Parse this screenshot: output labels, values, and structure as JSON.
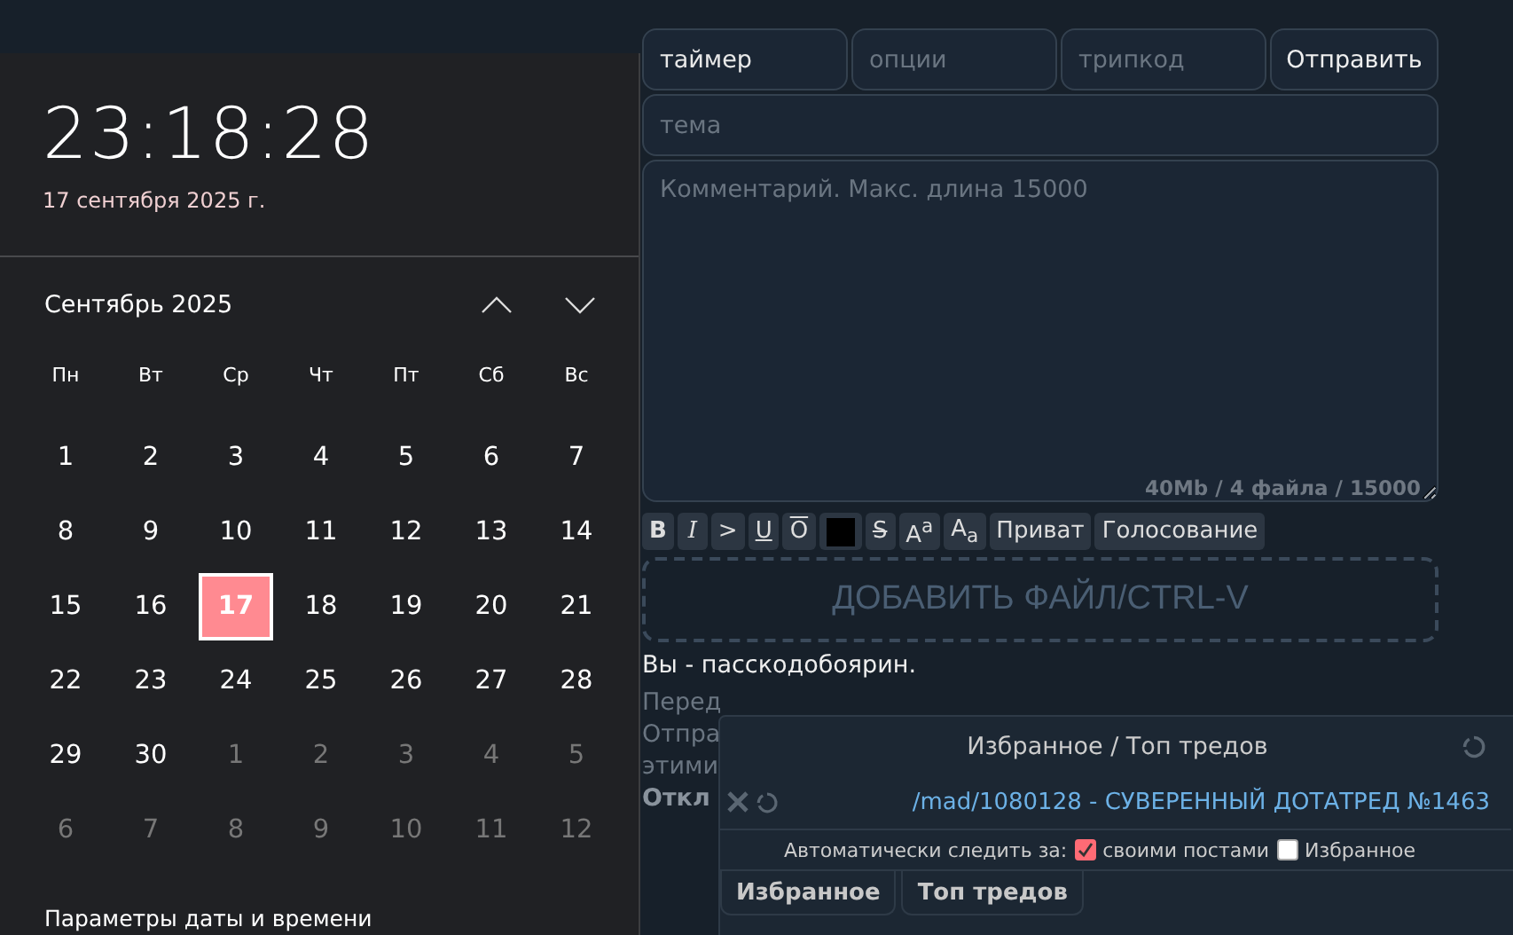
{
  "calendar": {
    "time": "23:18:28",
    "date": "17 сентября 2025 г.",
    "month": "Сентябрь 2025",
    "weekdays": [
      "Пн",
      "Вт",
      "Ср",
      "Чт",
      "Пт",
      "Сб",
      "Вс"
    ],
    "days": [
      {
        "label": "1",
        "selected": false,
        "other_month": false
      },
      {
        "label": "2",
        "selected": false,
        "other_month": false
      },
      {
        "label": "3",
        "selected": false,
        "other_month": false
      },
      {
        "label": "4",
        "selected": false,
        "other_month": false
      },
      {
        "label": "5",
        "selected": false,
        "other_month": false
      },
      {
        "label": "6",
        "selected": false,
        "other_month": false
      },
      {
        "label": "7",
        "selected": false,
        "other_month": false
      },
      {
        "label": "8",
        "selected": false,
        "other_month": false
      },
      {
        "label": "9",
        "selected": false,
        "other_month": false
      },
      {
        "label": "10",
        "selected": false,
        "other_month": false
      },
      {
        "label": "11",
        "selected": false,
        "other_month": false
      },
      {
        "label": "12",
        "selected": false,
        "other_month": false
      },
      {
        "label": "13",
        "selected": false,
        "other_month": false
      },
      {
        "label": "14",
        "selected": false,
        "other_month": false
      },
      {
        "label": "15",
        "selected": false,
        "other_month": false
      },
      {
        "label": "16",
        "selected": false,
        "other_month": false
      },
      {
        "label": "17",
        "selected": true,
        "other_month": false
      },
      {
        "label": "18",
        "selected": false,
        "other_month": false
      },
      {
        "label": "19",
        "selected": false,
        "other_month": false
      },
      {
        "label": "20",
        "selected": false,
        "other_month": false
      },
      {
        "label": "21",
        "selected": false,
        "other_month": false
      },
      {
        "label": "22",
        "selected": false,
        "other_month": false
      },
      {
        "label": "23",
        "selected": false,
        "other_month": false
      },
      {
        "label": "24",
        "selected": false,
        "other_month": false
      },
      {
        "label": "25",
        "selected": false,
        "other_month": false
      },
      {
        "label": "26",
        "selected": false,
        "other_month": false
      },
      {
        "label": "27",
        "selected": false,
        "other_month": false
      },
      {
        "label": "28",
        "selected": false,
        "other_month": false
      },
      {
        "label": "29",
        "selected": false,
        "other_month": false
      },
      {
        "label": "30",
        "selected": false,
        "other_month": false
      },
      {
        "label": "1",
        "selected": false,
        "other_month": true
      },
      {
        "label": "2",
        "selected": false,
        "other_month": true
      },
      {
        "label": "3",
        "selected": false,
        "other_month": true
      },
      {
        "label": "4",
        "selected": false,
        "other_month": true
      },
      {
        "label": "5",
        "selected": false,
        "other_month": true
      },
      {
        "label": "6",
        "selected": false,
        "other_month": true
      },
      {
        "label": "7",
        "selected": false,
        "other_month": true
      },
      {
        "label": "8",
        "selected": false,
        "other_month": true
      },
      {
        "label": "9",
        "selected": false,
        "other_month": true
      },
      {
        "label": "10",
        "selected": false,
        "other_month": true
      },
      {
        "label": "11",
        "selected": false,
        "other_month": true
      },
      {
        "label": "12",
        "selected": false,
        "other_month": true
      }
    ],
    "footer_link": "Параметры даты и времени"
  },
  "form": {
    "fields": [
      {
        "value": "таймер"
      },
      {
        "placeholder": "опции"
      },
      {
        "placeholder": "трипкод"
      }
    ],
    "submit": "Отправить",
    "subject": {
      "placeholder": "тема"
    },
    "comment": {
      "placeholder": "Комментарий. Макс. длина 15000"
    },
    "limits": "40Mb / 4 файла / 15000",
    "format_buttons": [
      {
        "kind": "bold",
        "label": "B"
      },
      {
        "kind": "italic",
        "label": "I"
      },
      {
        "kind": "plain",
        "label": ">"
      },
      {
        "kind": "underline",
        "label": "U"
      },
      {
        "kind": "overline",
        "label": "O"
      },
      {
        "kind": "color",
        "color": "#000000"
      },
      {
        "kind": "strike",
        "label": "S"
      },
      {
        "kind": "rich",
        "label": "A$^{a}$"
      },
      {
        "kind": "rich",
        "label": "A$_{a}$"
      },
      {
        "kind": "plain",
        "label": "Приват"
      },
      {
        "kind": "plain",
        "label": "Голосование"
      }
    ],
    "upload": "ДОБАВИТЬ ФАЙЛ/CTRL-V",
    "user_note": "Вы - пасскодобоярин.",
    "notice_lines": [
      {
        "text": "Перед",
        "bold": false
      },
      {
        "text": "Отпра",
        "bold": false
      },
      {
        "text": "этими",
        "bold": false
      },
      {
        "text": "Откл",
        "bold": true
      }
    ]
  },
  "popup": {
    "title": "Избранное / Топ тредов",
    "thread": "/mad/1080128 - СУВЕРЕННЫЙ ДОТАТРЕД №1463",
    "autowatch": "Автоматически следить за:",
    "options": [
      {
        "label": "своими постами",
        "checked": true
      },
      {
        "label": "Избранное",
        "checked": false
      }
    ],
    "tabs": [
      "Избранное",
      "Топ тредов"
    ]
  }
}
